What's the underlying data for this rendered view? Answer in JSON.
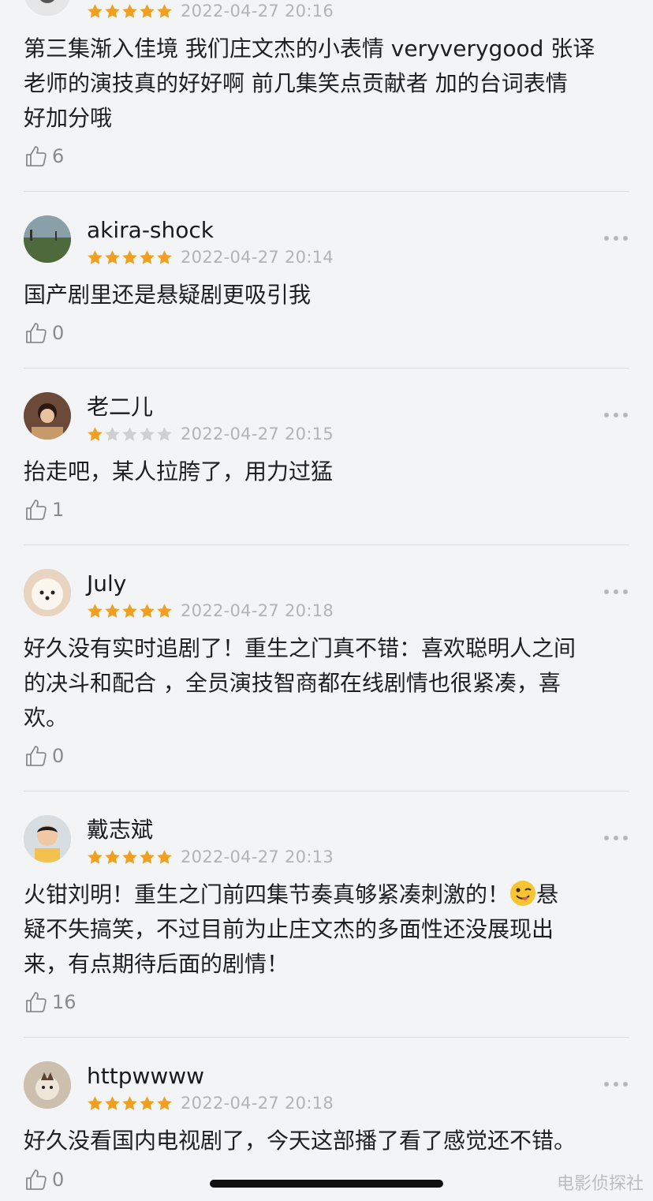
{
  "reviews": [
    {
      "username": "",
      "stars": 5,
      "time": "2022-04-27 20:16",
      "text": "第三集渐入佳境 我们庄文杰的小表情 veryverygood 张译\n老师的演技真的好好啊  前几集笑点贡献者  加的台词表情\n好加分哦",
      "likes": "6"
    },
    {
      "username": "akira-shock",
      "stars": 5,
      "time": "2022-04-27 20:14",
      "text": "国产剧里还是悬疑剧更吸引我",
      "likes": "0"
    },
    {
      "username": "老二儿",
      "stars": 1,
      "time": "2022-04-27 20:15",
      "text": "抬走吧，某人拉胯了，用力过猛",
      "likes": "1"
    },
    {
      "username": "July",
      "stars": 5,
      "time": "2022-04-27 20:18",
      "text": "好久没有实时追剧了！重生之门真不错：喜欢聪明人之间\n的决斗和配合 ，全员演技智商都在线剧情也很紧凑，喜\n欢。",
      "likes": "0"
    },
    {
      "username": "戴志斌",
      "stars": 5,
      "time": "2022-04-27 20:13",
      "text_before_emoji": "火钳刘明！重生之门前四集节奏真够紧凑刺激的！",
      "emoji": "winking-face-with-tongue",
      "text_after_emoji": "悬\n疑不失搞笑，不过目前为止庄文杰的多面性还没展现出\n来，有点期待后面的剧情！",
      "likes": "16"
    },
    {
      "username": "httpwwww",
      "stars": 5,
      "time": "2022-04-27 20:18",
      "text": "好久没看国内电视剧了，今天这部播了看了感觉还不错。",
      "likes": "0"
    }
  ],
  "watermark": "电影侦探社",
  "colors": {
    "star": "#f0a020",
    "star_empty": "#d0d0d0",
    "background": "#f3f4f6"
  },
  "icons": {
    "like": "thumbs-up-icon",
    "more": "more-dots-icon"
  }
}
